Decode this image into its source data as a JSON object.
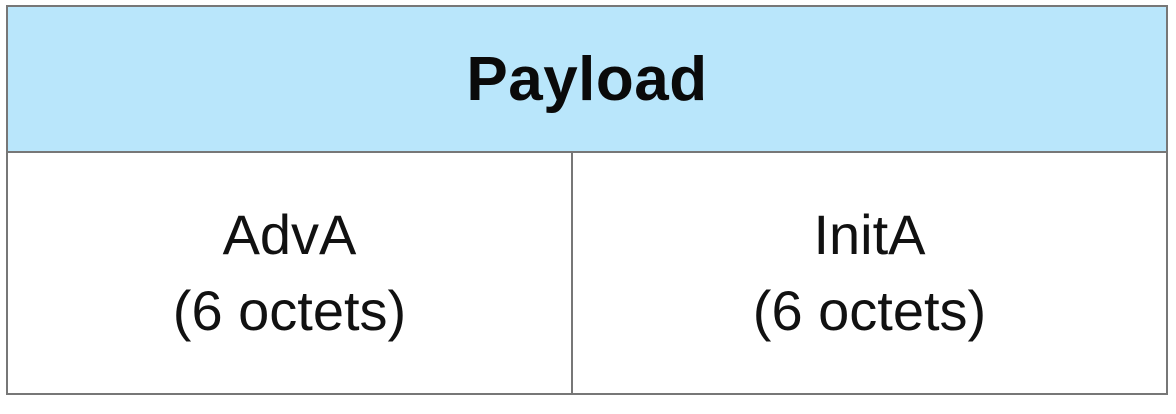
{
  "header": {
    "label": "Payload"
  },
  "fields": [
    {
      "name": "AdvA",
      "size": "(6 octets)"
    },
    {
      "name": "InitA",
      "size": "(6 octets)"
    }
  ],
  "colors": {
    "header_background": "#b9e6fb",
    "border": "#777777",
    "text": "#111111"
  }
}
